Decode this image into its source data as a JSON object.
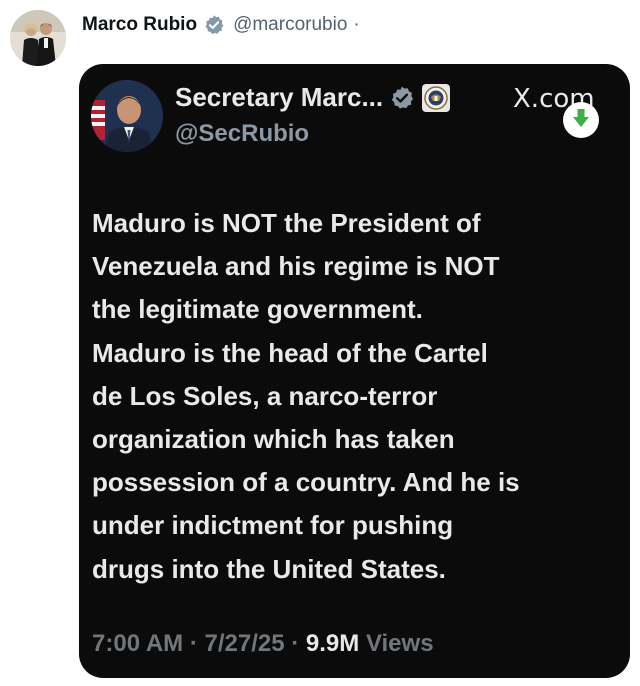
{
  "outer_post": {
    "author_name": "Marco Rubio",
    "author_handle": "@marcorubio",
    "separator": "·",
    "verified_icon": "verified-badge-icon"
  },
  "quoted_post": {
    "author_name": "Secretary Marc...",
    "author_handle": "@SecRubio",
    "verified_icon": "verified-badge-icon",
    "affiliation_icon": "state-department-seal-icon",
    "source_label": "X.com",
    "download_icon": "download-arrow-icon",
    "text_lines": [
      "Maduro is NOT the President of",
      "Venezuela and his regime is NOT",
      "the legitimate government.",
      "Maduro is the head of the Cartel",
      "de Los Soles, a narco-terror",
      "organization which has taken",
      "possession of a country.  And he is",
      "under indictment for pushing",
      "drugs into the United States."
    ],
    "time": "7:00 AM",
    "dot1": "·",
    "date": "7/27/25",
    "dot2": "·",
    "views_count": "9.9M",
    "views_label": "Views"
  },
  "colors": {
    "card_background": "#0b0b0b",
    "verified_blue": "#1d9bf0",
    "download_green": "#3cb043"
  }
}
